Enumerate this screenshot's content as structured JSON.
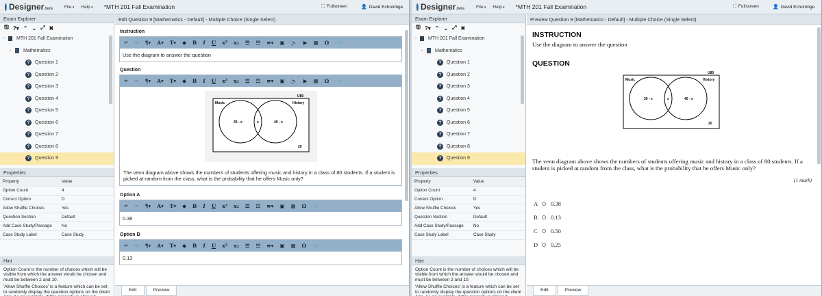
{
  "app": {
    "logo_text": "Designer",
    "logo_beta": "beta",
    "menu": [
      "File",
      "Help"
    ],
    "title": "*MTH 201 Fall Examination",
    "fullscreen_label": "Fullscreen",
    "user_name": "David Echombge"
  },
  "explorer": {
    "header": "Exam Explorer",
    "toolbar_icons": [
      "save-icon",
      "help-icon",
      "move-up-icon",
      "move-down-icon",
      "expand-icon",
      "collapse-icon"
    ],
    "root": "MTH 201 Fall Examination",
    "section": "Mathematics",
    "questions": [
      "Question 1",
      "Question 2",
      "Question 3",
      "Question 4",
      "Question 5",
      "Question 6",
      "Question 7",
      "Question 8",
      "Question 9"
    ],
    "selected_index": 8
  },
  "properties": {
    "header": "Properties",
    "col_property": "Property",
    "col_value": "Value",
    "rows": [
      {
        "k": "Option Count",
        "v": "4"
      },
      {
        "k": "Correct Option",
        "v": "D"
      },
      {
        "k": "Allow Shuffle Choices",
        "v": "Yes"
      },
      {
        "k": "Question Section",
        "v": "Default"
      },
      {
        "k": "Add Case Study/Passage",
        "v": "No"
      },
      {
        "k": "Case Study Label",
        "v": "Case Study"
      }
    ]
  },
  "hint": {
    "header": "Hint",
    "p1": "Option Count is the number of choices which will be visible from which the answer would be chosen and must be between 2 and 10.",
    "p2": "'Allow Shuffle Choices' is a feature which can be set to randomly display the question options on the client App. As an example, if this property is allowed, Option A may appear as"
  },
  "editor": {
    "header": "Edit Question 9 [Mathematics - Default] - Multiple Choice (Single Select)",
    "instruction_label": "Instruction",
    "instruction_text": "Use the diagram to answer the question",
    "question_label": "Question",
    "question_text": "The venn diagram above shows the numbers of students offering music and history in a class of 80 students. If a student is picked at random from the class, what is the probability that he offers Music only?",
    "option_a_label": "Option A",
    "option_a_value": "0.38",
    "option_b_label": "Option B",
    "option_b_value": "0.13",
    "tabs": [
      "Edit",
      "Preview"
    ]
  },
  "venn": {
    "universe": "U80",
    "left_label": "Music",
    "right_label": "History",
    "left_value": "30 - x",
    "middle_value": "x",
    "right_value": "40 - x",
    "outside_value": "20"
  },
  "preview": {
    "header": "Preview Question 9 [Mathematics - Default] - Multiple Choice (Single Select)",
    "instruction_heading": "INSTRUCTION",
    "instruction_text": "Use the diagram to answer the question",
    "question_heading": "QUESTION",
    "question_text": "The venn diagram above shows the numbers of students offering music and history in a class of 80 students. If a student is picked at random from the class, what is the probability that he offers Music only?",
    "mark": "(1 mark)",
    "options": [
      {
        "letter": "A",
        "value": "0.38"
      },
      {
        "letter": "B",
        "value": "0.13"
      },
      {
        "letter": "C",
        "value": "0.50"
      },
      {
        "letter": "D",
        "value": "0.25"
      }
    ],
    "tabs": [
      "Edit",
      "Preview"
    ]
  }
}
